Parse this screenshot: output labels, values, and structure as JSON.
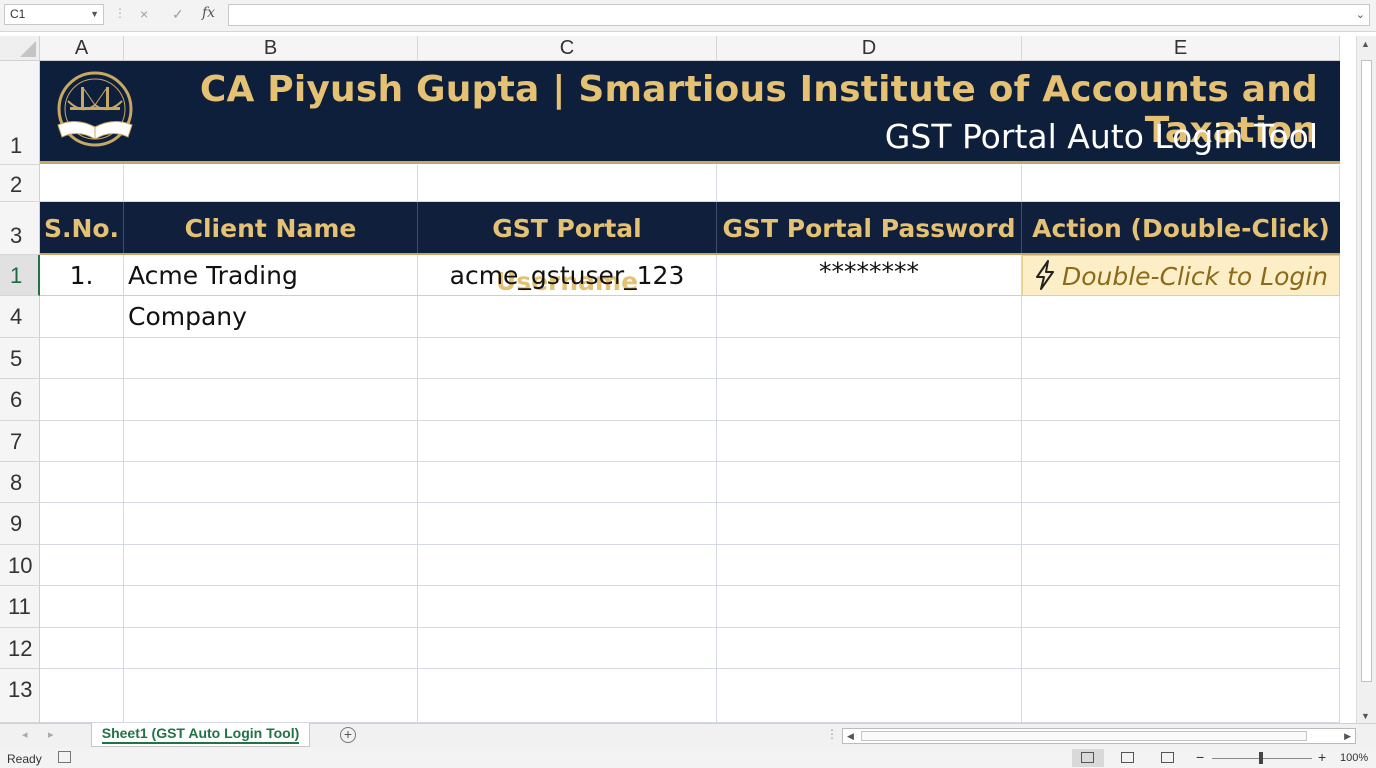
{
  "formula_bar": {
    "name_box": "C1",
    "fx_label": "fx",
    "cancel_icon": "×",
    "enter_icon": "✓",
    "formula": ""
  },
  "columns": [
    "A",
    "B",
    "C",
    "D",
    "E"
  ],
  "rows": [
    "1",
    "2",
    "3",
    "1",
    "4",
    "5",
    "6",
    "7",
    "8",
    "9",
    "10",
    "11",
    "12",
    "13"
  ],
  "banner": {
    "title": "CA Piyush Gupta | Smartious Institute of Accounts and Taxation",
    "subtitle": "GST Portal Auto Login Tool",
    "logo_icon": "bridge-book-logo"
  },
  "table": {
    "headers": [
      "S.No.",
      "Client Name",
      "GST Portal Username",
      "GST Portal Password",
      "Action (Double-Click)"
    ],
    "rows": [
      {
        "sno": "1.",
        "client_name": "Acme Trading Company",
        "username": "acme_gstuser_123",
        "password": "********",
        "action": "Double-Click to Login",
        "action_icon": "lightning-bolt-icon"
      }
    ]
  },
  "sheet_tabs": [
    {
      "label": "Sheet1 (GST Auto Login Tool)",
      "active": true
    }
  ],
  "status": {
    "text": "Ready",
    "zoom": "100%"
  },
  "colors": {
    "navy": "#0e1f3c",
    "gold": "#e5c173",
    "action_bg": "#fcefc8",
    "excel_green": "#217346"
  }
}
